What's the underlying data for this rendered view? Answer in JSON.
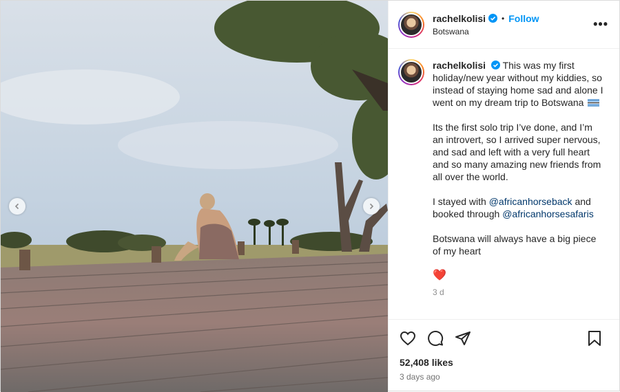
{
  "post": {
    "username": "rachelkolisi",
    "location": "Botswana",
    "follow_label": "Follow",
    "separator": "•",
    "more_label": "•••"
  },
  "caption": {
    "username": "rachelkolisi",
    "p1": "This was my first holiday/new year without my kiddies, so instead of staying home sad and alone I went on my dream trip to Botswana",
    "p2": "Its the first solo trip I’ve done, and I’m an introvert, so I arrived super nervous, and sad and left with a very full heart and so many amazing new friends from all over the world.",
    "p3_before": "I stayed with",
    "mention1": "@africanhorseback",
    "p3_mid": "and booked through",
    "mention2": "@africanhorsesafaris",
    "p4": "Botswana will always have a big piece of my heart",
    "heart": "❤️",
    "age": "3 d"
  },
  "footer": {
    "likes": "52,408 likes",
    "date": "3 days ago"
  },
  "icons": {
    "like": "heart-icon",
    "comment": "comment-icon",
    "share": "share-icon",
    "save": "bookmark-icon",
    "verified": "verified-badge-icon",
    "prev": "chevron-left-icon",
    "next": "chevron-right-icon"
  },
  "colors": {
    "accent": "#0095f6",
    "mention": "#00376b",
    "verified": "#0095f6"
  }
}
